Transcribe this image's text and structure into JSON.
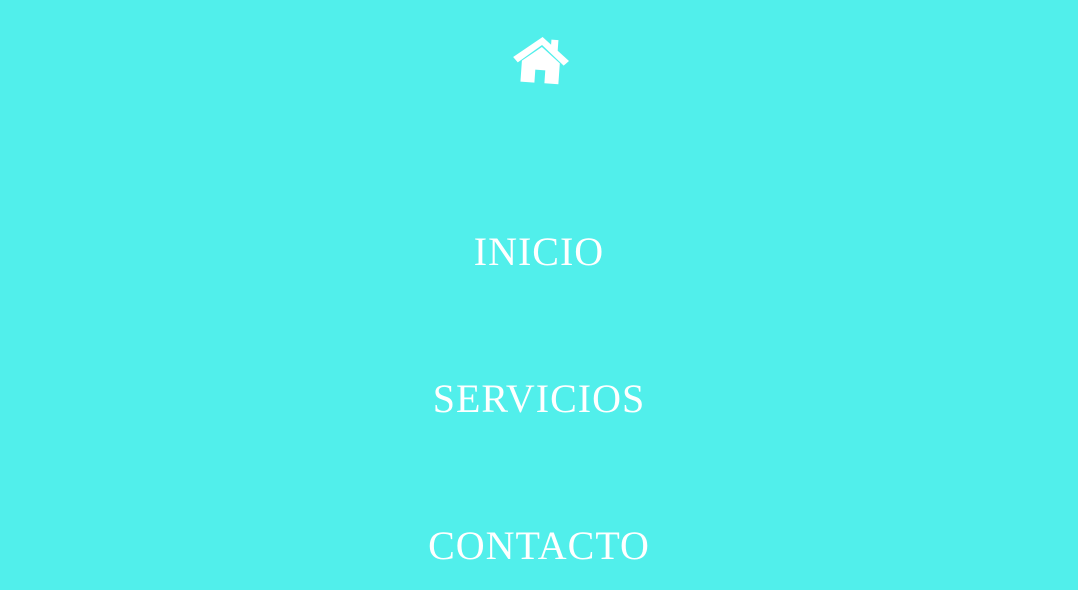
{
  "theme": {
    "background": "#51EFEB",
    "foreground": "#FFFFFF"
  },
  "header": {
    "icon": "home-icon"
  },
  "nav": {
    "items": [
      {
        "label": "INICIO"
      },
      {
        "label": "SERVICIOS"
      },
      {
        "label": "CONTACTO"
      }
    ]
  }
}
